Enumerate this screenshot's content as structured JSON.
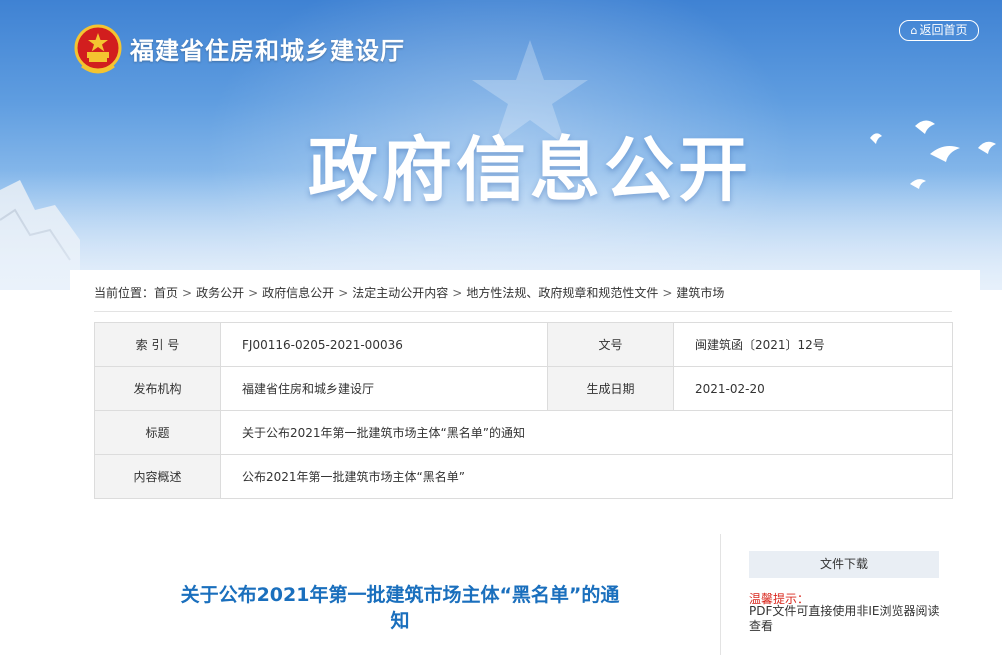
{
  "header": {
    "org_name": "福建省住房和城乡建设厅",
    "back_home": "返回首页",
    "hero_title": "政府信息公开",
    "colors": {
      "banner_top": "#3f82d3",
      "accent": "#1a6fbd",
      "tip": "#d9281e"
    }
  },
  "breadcrumb": {
    "prefix": "当前位置：",
    "items": [
      "首页",
      "政务公开",
      "政府信息公开",
      "法定主动公开内容",
      "地方性法规、政府规章和规范性文件",
      "建筑市场"
    ],
    "separator": ">"
  },
  "info": {
    "index_label": "索 引 号",
    "index_value": "FJ00116-0205-2021-00036",
    "docno_label": "文号",
    "docno_value": "闽建筑函〔2021〕12号",
    "publisher_label": "发布机构",
    "publisher_value": "福建省住房和城乡建设厅",
    "date_label": "生成日期",
    "date_value": "2021-02-20",
    "title_label": "标题",
    "title_value": "关于公布2021年第一批建筑市场主体“黑名单”的通知",
    "summary_label": "内容概述",
    "summary_value": "公布2021年第一批建筑市场主体“黑名单”"
  },
  "article": {
    "title": "关于公布2021年第一批建筑市场主体“黑名单”的通知"
  },
  "sidebar": {
    "download_label": "文件下载",
    "tip_title": "温馨提示：",
    "tip_text": "PDF文件可直接使用非IE浏览器阅读查看"
  }
}
